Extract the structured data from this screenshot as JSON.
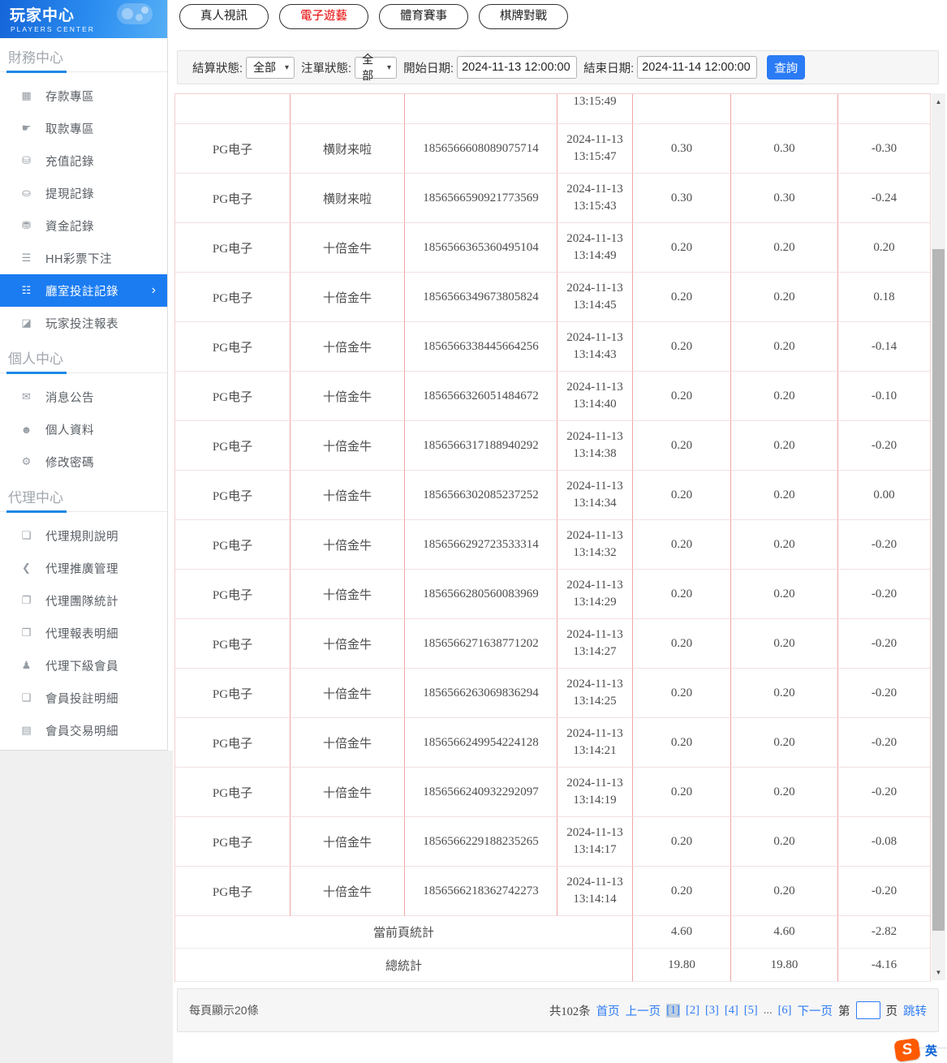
{
  "app": {
    "accent_blue": "#1b7cf2",
    "tab_red": "#e60000",
    "link_blue": "#2f7cf6",
    "table_border_pink": "#efa5a5"
  },
  "icons": {
    "select_arrow": "▾",
    "scroll_up": "▲",
    "scroll_down": "▼",
    "active_chevron": "›"
  },
  "sidebar": {
    "logo_title": "玩家中心",
    "logo_subtitle": "PLAYERS CENTER",
    "sections": [
      {
        "title": "財務中心",
        "items": [
          {
            "label": "存款專區",
            "icon": "deposit",
            "glyph": "▦"
          },
          {
            "label": "取款專區",
            "icon": "withdraw",
            "glyph": "☛"
          },
          {
            "label": "充值記錄",
            "icon": "recharge-record",
            "glyph": "⛁"
          },
          {
            "label": "提現記錄",
            "icon": "cashout-record",
            "glyph": "⛀"
          },
          {
            "label": "資金記錄",
            "icon": "funds-record",
            "glyph": "⛃"
          },
          {
            "label": "HH彩票下注",
            "icon": "lottery-bet",
            "glyph": "☰"
          },
          {
            "label": "廳室投註記錄",
            "icon": "room-bet-record",
            "glyph": "☷",
            "active": true,
            "chevron": "›"
          },
          {
            "label": "玩家投注報表",
            "icon": "player-bet-report",
            "glyph": "◪"
          }
        ]
      },
      {
        "title": "個人中心",
        "items": [
          {
            "label": "消息公告",
            "icon": "notice",
            "glyph": "✉"
          },
          {
            "label": "個人資料",
            "icon": "profile",
            "glyph": "☻"
          },
          {
            "label": "修改密碼",
            "icon": "change-password",
            "glyph": "⚙"
          }
        ]
      },
      {
        "title": "代理中心",
        "items": [
          {
            "label": "代理規則說明",
            "icon": "agent-rules",
            "glyph": "❏"
          },
          {
            "label": "代理推廣管理",
            "icon": "agent-promotion",
            "glyph": "❮"
          },
          {
            "label": "代理團隊統計",
            "icon": "agent-team-stats",
            "glyph": "❐"
          },
          {
            "label": "代理報表明細",
            "icon": "agent-report-detail",
            "glyph": "❒"
          },
          {
            "label": "代理下級會員",
            "icon": "agent-sub-members",
            "glyph": "♟"
          },
          {
            "label": "會員投註明細",
            "icon": "member-bet-detail",
            "glyph": "❑"
          },
          {
            "label": "會員交易明細",
            "icon": "member-trade-detail",
            "glyph": "▤"
          }
        ]
      }
    ]
  },
  "tabs": [
    {
      "label": "真人視訊",
      "active": false
    },
    {
      "label": "電子遊藝",
      "active": true
    },
    {
      "label": "體育賽事",
      "active": false
    },
    {
      "label": "棋牌對戰",
      "active": false
    }
  ],
  "filters": {
    "settle_label": "結算狀態:",
    "settle_value": "全部",
    "order_label": "注單狀態:",
    "order_value": "全部",
    "start_label": "開始日期:",
    "start_value": "2024-11-13 12:00:00",
    "end_label": "結束日期:",
    "end_value": "2024-11-14 12:00:00",
    "search_label": "查詢"
  },
  "table": {
    "partial_row_time": "13:15:49",
    "rows": [
      {
        "platform": "PG电子",
        "game": "横财来啦",
        "order": "1856566608089075714",
        "date": "2024-11-13",
        "time": "13:15:47",
        "bet": "0.30",
        "valid": "0.30",
        "winloss": "-0.30"
      },
      {
        "platform": "PG电子",
        "game": "横财来啦",
        "order": "1856566590921773569",
        "date": "2024-11-13",
        "time": "13:15:43",
        "bet": "0.30",
        "valid": "0.30",
        "winloss": "-0.24"
      },
      {
        "platform": "PG电子",
        "game": "十倍金牛",
        "order": "1856566365360495104",
        "date": "2024-11-13",
        "time": "13:14:49",
        "bet": "0.20",
        "valid": "0.20",
        "winloss": "0.20"
      },
      {
        "platform": "PG电子",
        "game": "十倍金牛",
        "order": "1856566349673805824",
        "date": "2024-11-13",
        "time": "13:14:45",
        "bet": "0.20",
        "valid": "0.20",
        "winloss": "0.18"
      },
      {
        "platform": "PG电子",
        "game": "十倍金牛",
        "order": "1856566338445664256",
        "date": "2024-11-13",
        "time": "13:14:43",
        "bet": "0.20",
        "valid": "0.20",
        "winloss": "-0.14"
      },
      {
        "platform": "PG电子",
        "game": "十倍金牛",
        "order": "1856566326051484672",
        "date": "2024-11-13",
        "time": "13:14:40",
        "bet": "0.20",
        "valid": "0.20",
        "winloss": "-0.10"
      },
      {
        "platform": "PG电子",
        "game": "十倍金牛",
        "order": "1856566317188940292",
        "date": "2024-11-13",
        "time": "13:14:38",
        "bet": "0.20",
        "valid": "0.20",
        "winloss": "-0.20"
      },
      {
        "platform": "PG电子",
        "game": "十倍金牛",
        "order": "1856566302085237252",
        "date": "2024-11-13",
        "time": "13:14:34",
        "bet": "0.20",
        "valid": "0.20",
        "winloss": "0.00"
      },
      {
        "platform": "PG电子",
        "game": "十倍金牛",
        "order": "1856566292723533314",
        "date": "2024-11-13",
        "time": "13:14:32",
        "bet": "0.20",
        "valid": "0.20",
        "winloss": "-0.20"
      },
      {
        "platform": "PG电子",
        "game": "十倍金牛",
        "order": "1856566280560083969",
        "date": "2024-11-13",
        "time": "13:14:29",
        "bet": "0.20",
        "valid": "0.20",
        "winloss": "-0.20"
      },
      {
        "platform": "PG电子",
        "game": "十倍金牛",
        "order": "1856566271638771202",
        "date": "2024-11-13",
        "time": "13:14:27",
        "bet": "0.20",
        "valid": "0.20",
        "winloss": "-0.20"
      },
      {
        "platform": "PG电子",
        "game": "十倍金牛",
        "order": "1856566263069836294",
        "date": "2024-11-13",
        "time": "13:14:25",
        "bet": "0.20",
        "valid": "0.20",
        "winloss": "-0.20"
      },
      {
        "platform": "PG电子",
        "game": "十倍金牛",
        "order": "1856566249954224128",
        "date": "2024-11-13",
        "time": "13:14:21",
        "bet": "0.20",
        "valid": "0.20",
        "winloss": "-0.20"
      },
      {
        "platform": "PG电子",
        "game": "十倍金牛",
        "order": "1856566240932292097",
        "date": "2024-11-13",
        "time": "13:14:19",
        "bet": "0.20",
        "valid": "0.20",
        "winloss": "-0.20"
      },
      {
        "platform": "PG电子",
        "game": "十倍金牛",
        "order": "1856566229188235265",
        "date": "2024-11-13",
        "time": "13:14:17",
        "bet": "0.20",
        "valid": "0.20",
        "winloss": "-0.08"
      },
      {
        "platform": "PG电子",
        "game": "十倍金牛",
        "order": "1856566218362742273",
        "date": "2024-11-13",
        "time": "13:14:14",
        "bet": "0.20",
        "valid": "0.20",
        "winloss": "-0.20"
      }
    ],
    "summary_rows": [
      {
        "label": "當前頁統計",
        "bet": "4.60",
        "valid": "4.60",
        "winloss": "-2.82"
      },
      {
        "label": "總統計",
        "bet": "19.80",
        "valid": "19.80",
        "winloss": "-4.16"
      }
    ]
  },
  "pagination": {
    "page_size_text": "每頁顯示20條",
    "total_text": "共102条",
    "first": "首页",
    "prev": "上一页",
    "pages": [
      {
        "label": "[1]",
        "current": true
      },
      {
        "label": "[2]"
      },
      {
        "label": "[3]"
      },
      {
        "label": "[4]"
      },
      {
        "label": "[5]"
      },
      {
        "label": "...",
        "ellipsis": true
      },
      {
        "label": "[6]"
      }
    ],
    "next": "下一页",
    "jump_prefix": "第",
    "jump_suffix": "页",
    "jump_label": "跳转",
    "jump_value": ""
  },
  "translator": {
    "badge": "S",
    "lang": "英"
  }
}
